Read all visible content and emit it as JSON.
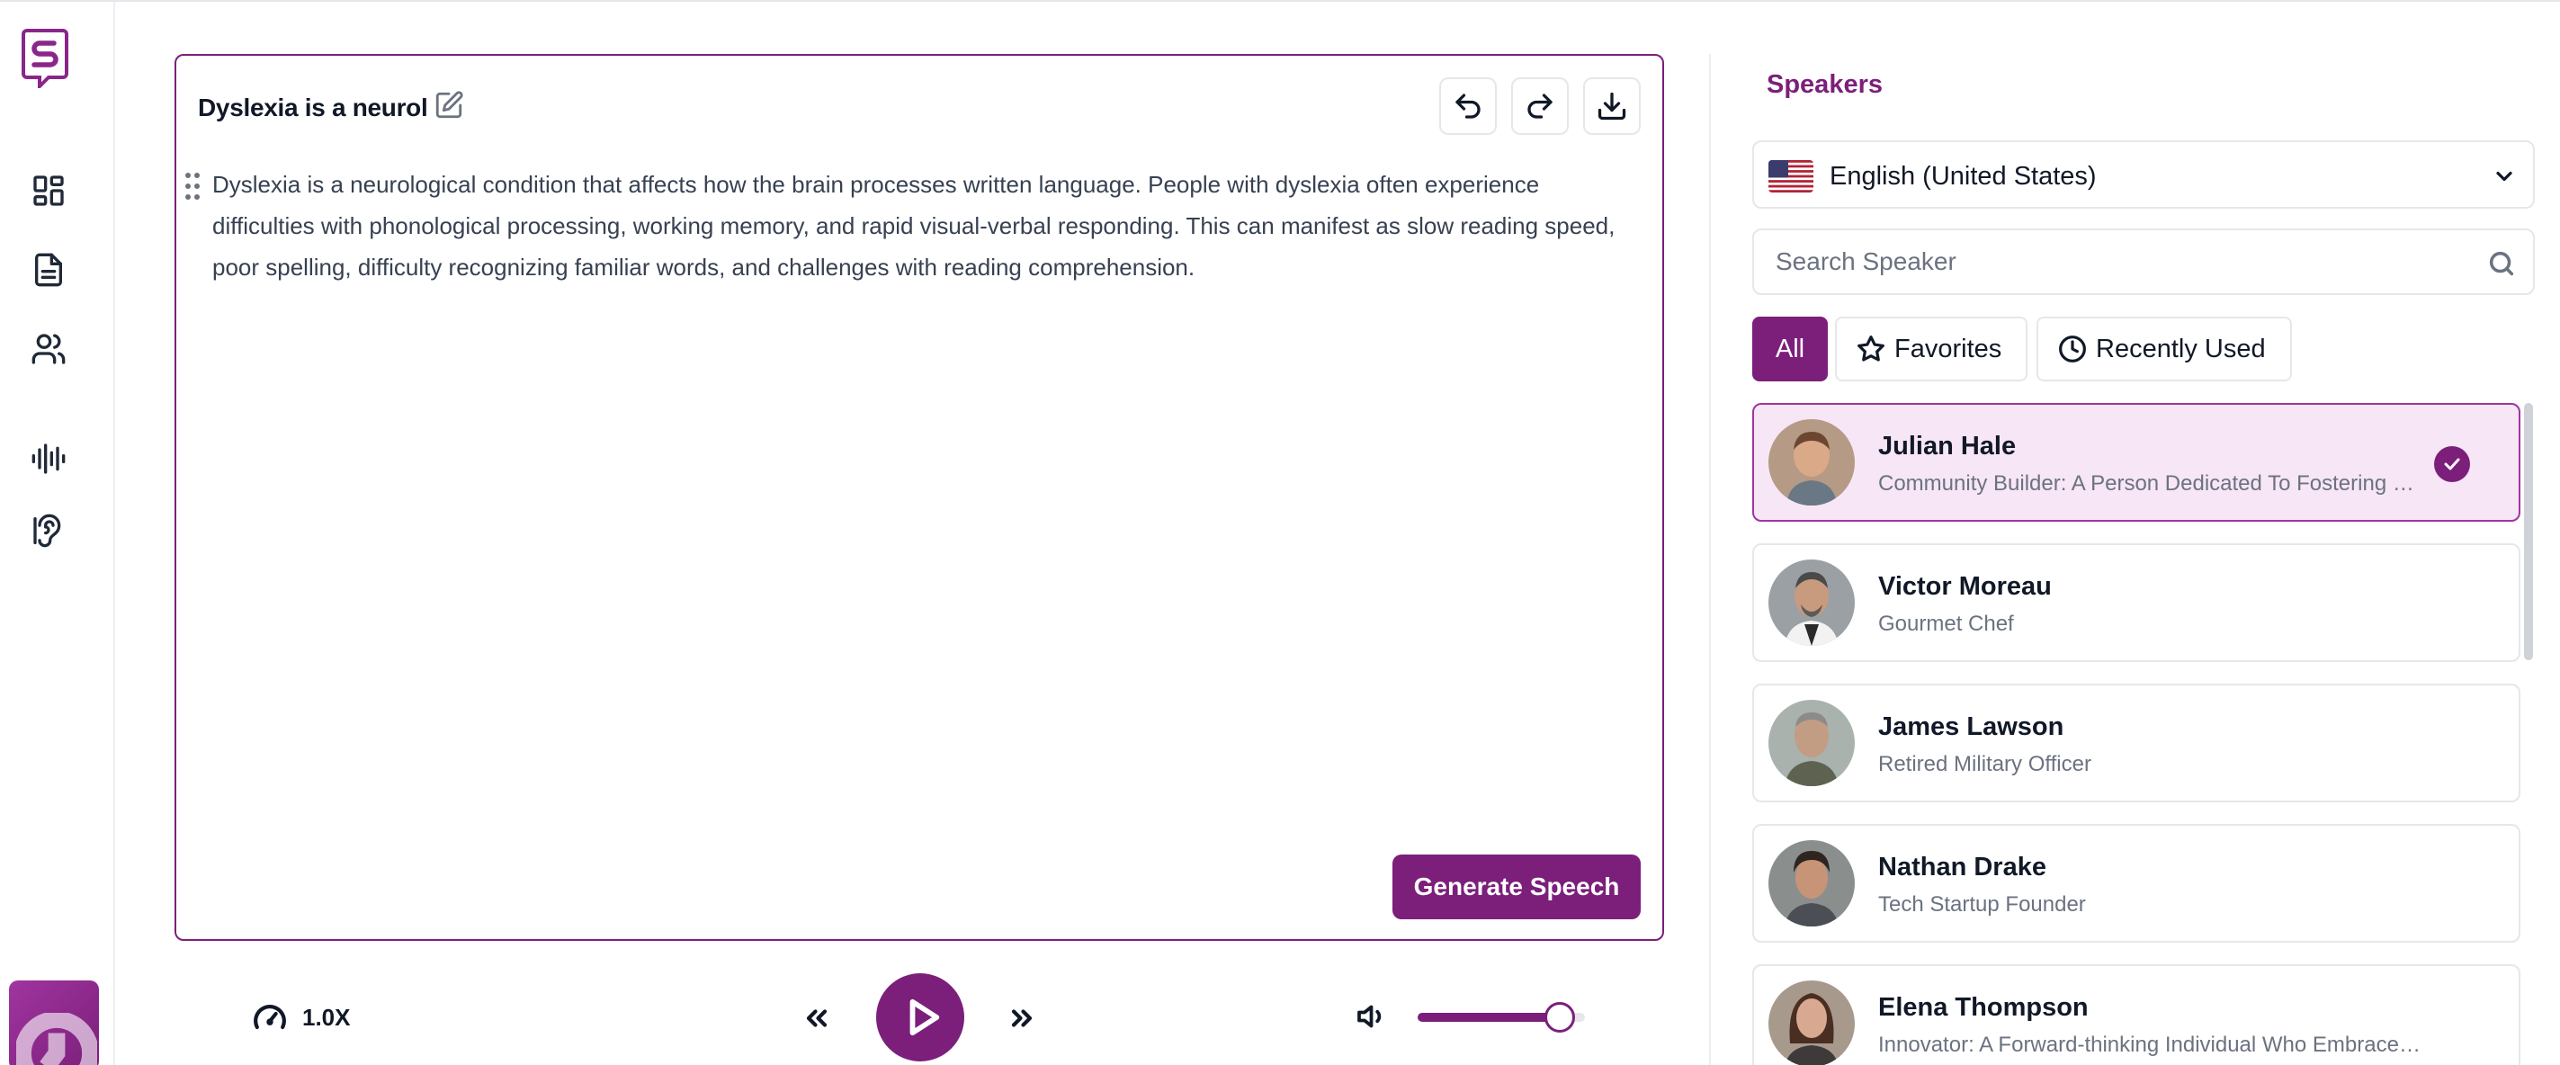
{
  "editor": {
    "title": "Dyslexia is a neurol",
    "body": "Dyslexia is a neurological condition that affects how the brain processes written language. People with dyslexia often experience difficulties with phonological processing, working memory, and rapid visual-verbal responding. This can manifest as slow reading speed, poor spelling, difficulty recognizing familiar words, and challenges with reading comprehension.",
    "generate_label": "Generate Speech"
  },
  "player": {
    "speed_label": "1.0X",
    "volume_percent": 85
  },
  "panel": {
    "title": "Speakers",
    "language": "English (United States)",
    "search_placeholder": "Search Speaker",
    "filters": {
      "all": "All",
      "favorites": "Favorites",
      "recent": "Recently Used"
    }
  },
  "speakers": [
    {
      "name": "Julian Hale",
      "desc": "Community Builder: A Person Dedicated To Fostering Connections",
      "selected": true
    },
    {
      "name": "Victor Moreau",
      "desc": "Gourmet Chef",
      "selected": false
    },
    {
      "name": "James Lawson",
      "desc": "Retired Military Officer",
      "selected": false
    },
    {
      "name": "Nathan Drake",
      "desc": "Tech Startup Founder",
      "selected": false
    },
    {
      "name": "Elena Thompson",
      "desc": "Innovator: A Forward-thinking Individual Who Embraces New Ideas",
      "selected": false
    }
  ],
  "colors": {
    "accent": "#7b1f7b",
    "selected_bg": "#f7e6f6",
    "border": "#e5e7eb"
  }
}
